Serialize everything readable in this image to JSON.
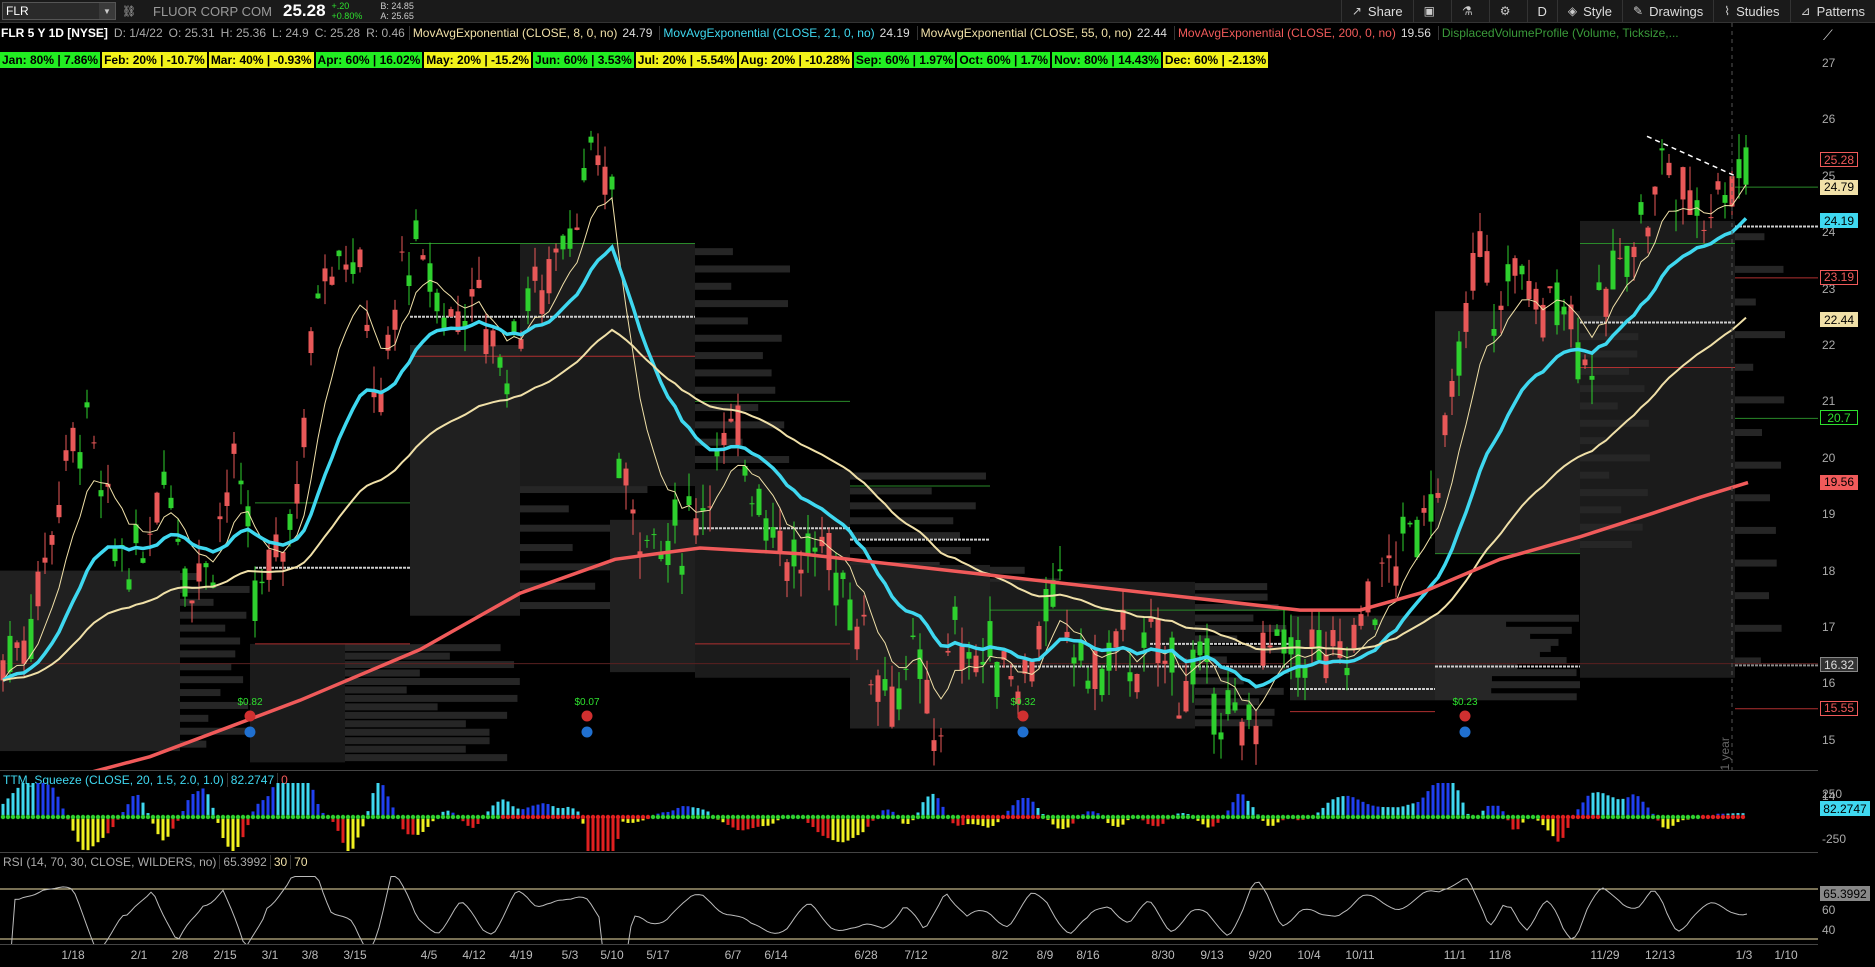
{
  "toolbar": {
    "symbol": "FLR",
    "company": "FLUOR CORP COM",
    "last": "25.28",
    "change": "+.20",
    "change_pct": "+0.80%",
    "bid": "B: 24.85",
    "ask": "A: 25.65",
    "share_label": "Share",
    "timeframe_label": "D",
    "style_label": "Style",
    "drawings_label": "Drawings",
    "studies_label": "Studies",
    "patterns_label": "Patterns"
  },
  "infoline": {
    "ticker": "FLR 5 Y 1D [NYSE]",
    "date": "D: 1/4/22",
    "open": "O: 25.31",
    "high": "H: 25.36",
    "low": "L: 24.9",
    "close": "C: 25.28",
    "range": "R: 0.46",
    "studies": [
      {
        "label": "MovAvgExponential (CLOSE, 8, 0, no)",
        "value": "24.79",
        "color": "#f0e0a8"
      },
      {
        "label": "MovAvgExponential (CLOSE, 21, 0, no)",
        "value": "24.19",
        "color": "#3fd8f0"
      },
      {
        "label": "MovAvgExponential (CLOSE, 55, 0, no)",
        "value": "22.44",
        "color": "#f0e0a8"
      },
      {
        "label": "MovAvgExponential (CLOSE, 200, 0, no)",
        "value": "19.56",
        "color": "#f05a5a"
      },
      {
        "label": "DisplacedVolumeProfile (Volume, Ticksize,...",
        "value": "",
        "color": "#3a9a3a"
      }
    ]
  },
  "seasonality": [
    {
      "text": "Jan: 80% | 7.86%",
      "color": "#22ee22"
    },
    {
      "text": "Feb: 20% | -10.7%",
      "color": "#f2f21a"
    },
    {
      "text": "Mar: 40% | -0.93%",
      "color": "#f2f21a"
    },
    {
      "text": "Apr: 60% | 16.02%",
      "color": "#22ee22"
    },
    {
      "text": "May: 20% | -15.2%",
      "color": "#f2f21a"
    },
    {
      "text": "Jun: 60% | 3.53%",
      "color": "#22ee22"
    },
    {
      "text": "Jul: 20% | -5.54%",
      "color": "#f2f21a"
    },
    {
      "text": "Aug: 20% | -10.28%",
      "color": "#f2f21a"
    },
    {
      "text": "Sep: 60% | 1.97%",
      "color": "#22ee22"
    },
    {
      "text": "Oct: 60% | 1.7%",
      "color": "#22ee22"
    },
    {
      "text": "Nov: 80% | 14.43%",
      "color": "#22ee22"
    },
    {
      "text": "Dec: 60% | -2.13%",
      "color": "#f2f21a"
    }
  ],
  "price_axis": {
    "ticks": [
      "27",
      "26",
      "25",
      "24",
      "23",
      "22",
      "21",
      "20",
      "19",
      "18",
      "17",
      "16",
      "15",
      "14"
    ],
    "tick_values": [
      27,
      26,
      25,
      24,
      23,
      22,
      21,
      20,
      19,
      18,
      17,
      16,
      15,
      14
    ],
    "badges": [
      {
        "text": "25.28",
        "value": 25.28,
        "bg": "#000",
        "fg": "#f05a5a",
        "border": "#f05a5a"
      },
      {
        "text": "24.79",
        "value": 24.79,
        "bg": "#f0e0a8",
        "fg": "#000",
        "border": "#f0e0a8"
      },
      {
        "text": "24.19",
        "value": 24.19,
        "bg": "#3fd8f0",
        "fg": "#000",
        "border": "#3fd8f0"
      },
      {
        "text": "23.19",
        "value": 23.19,
        "bg": "#000",
        "fg": "#f05a5a",
        "border": "#f05a5a"
      },
      {
        "text": "22.44",
        "value": 22.44,
        "bg": "#f0e0a8",
        "fg": "#000",
        "border": "#f0e0a8"
      },
      {
        "text": "20.7",
        "value": 20.7,
        "bg": "#000",
        "fg": "#2ee02e",
        "border": "#2ee02e"
      },
      {
        "text": "19.56",
        "value": 19.56,
        "bg": "#f05a5a",
        "fg": "#000",
        "border": "#f05a5a"
      },
      {
        "text": "16.32",
        "value": 16.32,
        "bg": "#333",
        "fg": "#ddd",
        "border": "#888"
      },
      {
        "text": "15.55",
        "value": 15.55,
        "bg": "#000",
        "fg": "#f05a5a",
        "border": "#f05a5a"
      }
    ]
  },
  "chart_data": {
    "type": "candlestick",
    "instrument": "FLR",
    "price_range": [
      14,
      27
    ],
    "ema_close": {
      "ema8": 24.79,
      "ema21": 24.19,
      "ema55": 22.44,
      "ema200": 19.56
    },
    "dividends": [
      {
        "date": "2/22",
        "amount": "$0.82"
      },
      {
        "date": "5/11",
        "amount": "$0.07"
      },
      {
        "date": "8/10",
        "amount": "$0.32"
      },
      {
        "date": "11/2",
        "amount": "$0.23"
      }
    ],
    "annotation": "2021 year",
    "date_ticks": [
      "1/18",
      "2/1",
      "2/8",
      "2/15",
      "3/1",
      "3/8",
      "3/15",
      "4/5",
      "4/12",
      "4/19",
      "5/3",
      "5/10",
      "5/17",
      "6/7",
      "6/14",
      "6/28",
      "7/12",
      "8/2",
      "8/9",
      "8/16",
      "8/30",
      "9/13",
      "9/20",
      "10/4",
      "10/11",
      "11/1",
      "11/8",
      "11/29",
      "12/13",
      "1/3",
      "1/10"
    ]
  },
  "squeeze": {
    "label": "TTM_Squeeze (CLOSE, 20, 1.5, 2.0, 1.0)",
    "value": "82.2747",
    "alert": "0",
    "axis": [
      "250",
      "-250"
    ],
    "badge": "82.2747"
  },
  "rsi": {
    "label": "RSI (14, 70, 30, CLOSE, WILDERS, no)",
    "value": "65.3992",
    "oversold": "30",
    "overbought": "70",
    "axis": [
      "60",
      "40"
    ],
    "badge": "65.3992"
  }
}
